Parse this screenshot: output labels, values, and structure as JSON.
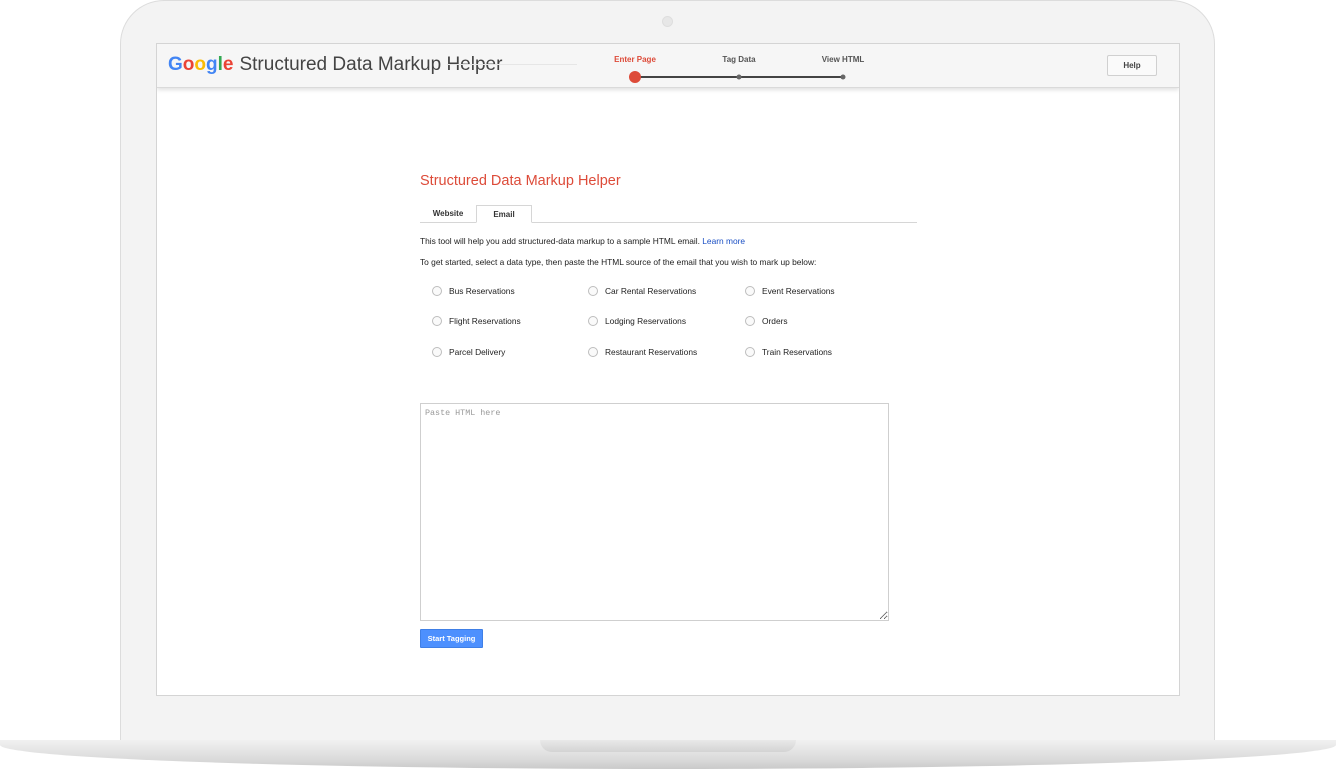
{
  "header": {
    "logo": {
      "letters": [
        {
          "char": "G",
          "color": "#4285f4"
        },
        {
          "char": "o",
          "color": "#ea4335"
        },
        {
          "char": "o",
          "color": "#fbbc05"
        },
        {
          "char": "g",
          "color": "#4285f4"
        },
        {
          "char": "l",
          "color": "#34a853"
        },
        {
          "char": "e",
          "color": "#ea4335"
        }
      ],
      "product_name": "Structured Data Markup Helper"
    },
    "steps": [
      {
        "label": "Enter Page",
        "active": true
      },
      {
        "label": "Tag Data",
        "active": false
      },
      {
        "label": "View HTML",
        "active": false
      }
    ],
    "help_label": "Help"
  },
  "main": {
    "title": "Structured Data Markup Helper",
    "tabs": [
      {
        "label": "Website",
        "selected": false
      },
      {
        "label": "Email",
        "selected": true
      }
    ],
    "intro_text": "This tool will help you add structured-data markup to a sample HTML email.",
    "learn_more": "Learn more",
    "instructions": "To get started, select a data type, then paste the HTML source of the email that you wish to mark up below:",
    "data_types": [
      "Bus Reservations",
      "Car Rental Reservations",
      "Event Reservations",
      "Flight Reservations",
      "Lodging Reservations",
      "Orders",
      "Parcel Delivery",
      "Restaurant Reservations",
      "Train Reservations"
    ],
    "paste_placeholder": "Paste HTML here",
    "start_button": "Start Tagging"
  },
  "colors": {
    "accent_red": "#dd4b39",
    "button_blue": "#4d90fe",
    "link_blue": "#1a4fc4"
  }
}
